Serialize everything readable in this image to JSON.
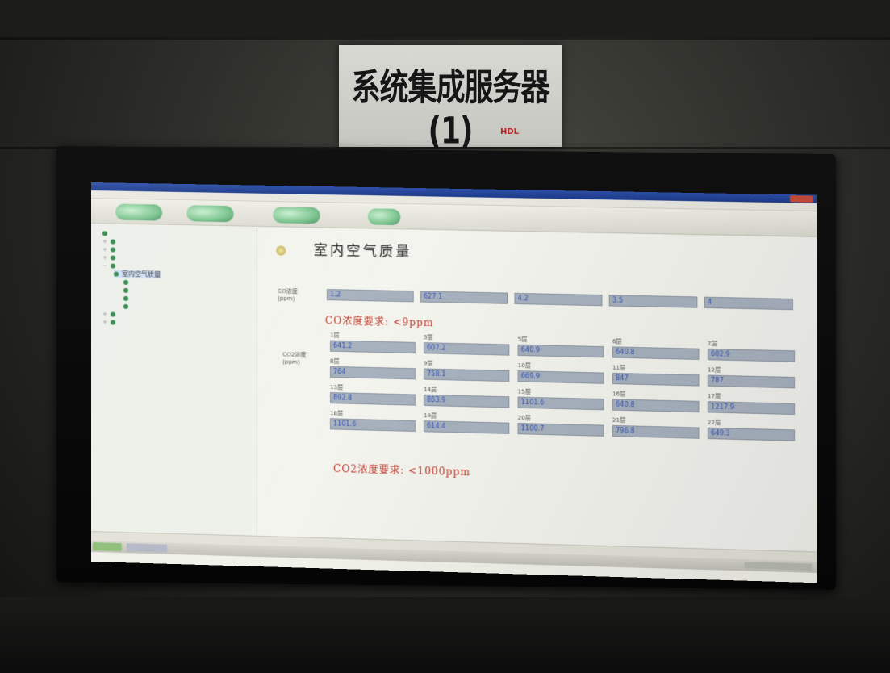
{
  "sign": {
    "title": "系统集成服务器(1)",
    "sub": "HDL"
  },
  "app": {
    "window_title": "",
    "menus": [
      "",
      "",
      ""
    ]
  },
  "toolbar": {
    "buttons": [
      "",
      "",
      "",
      ""
    ]
  },
  "sidebar": {
    "items": [
      {
        "label": "",
        "level": 0
      },
      {
        "label": "",
        "level": 0
      },
      {
        "label": "",
        "level": 0
      },
      {
        "label": "",
        "level": 0
      },
      {
        "label": "",
        "level": 0
      },
      {
        "label": "室内空气质量",
        "level": 1
      },
      {
        "label": "",
        "level": 2
      },
      {
        "label": "",
        "level": 2
      },
      {
        "label": "",
        "level": 2
      },
      {
        "label": "",
        "level": 2
      },
      {
        "label": "",
        "level": 0
      },
      {
        "label": "",
        "level": 0
      }
    ]
  },
  "main": {
    "title": "室内空气质量",
    "co": {
      "row_label": "CO浓度(ppm)",
      "columns": [
        "",
        "",
        "",
        "",
        ""
      ],
      "values": [
        "1.2",
        "627.1",
        "4.2",
        "3.5",
        "4"
      ]
    },
    "co_standard": "CO浓度要求: <9ppm",
    "co2": {
      "row_label": "CO2浓度(ppm)",
      "cells": [
        {
          "label": "1层",
          "value": "641.2"
        },
        {
          "label": "3层",
          "value": "607.2"
        },
        {
          "label": "5层",
          "value": "640.9"
        },
        {
          "label": "6层",
          "value": "640.8"
        },
        {
          "label": "7层",
          "value": "602.9"
        },
        {
          "label": "8层",
          "value": "764"
        },
        {
          "label": "9层",
          "value": "758.1"
        },
        {
          "label": "10层",
          "value": "669.9"
        },
        {
          "label": "11层",
          "value": "847"
        },
        {
          "label": "12层",
          "value": "787"
        },
        {
          "label": "13层",
          "value": "892.8"
        },
        {
          "label": "14层",
          "value": "863.9"
        },
        {
          "label": "15层",
          "value": "1101.6"
        },
        {
          "label": "16层",
          "value": "640.8"
        },
        {
          "label": "17层",
          "value": "1217.9"
        },
        {
          "label": "18层",
          "value": "1101.6"
        },
        {
          "label": "19层",
          "value": "614.4"
        },
        {
          "label": "20层",
          "value": "1100.7"
        },
        {
          "label": "21层",
          "value": "796.8"
        },
        {
          "label": "22层",
          "value": "649.3"
        }
      ]
    },
    "co2_standard": "CO2浓度要求: <1000ppm"
  },
  "status": {
    "left": "",
    "middle": "",
    "right": ""
  },
  "taskbar": {
    "start": "",
    "item": ""
  }
}
